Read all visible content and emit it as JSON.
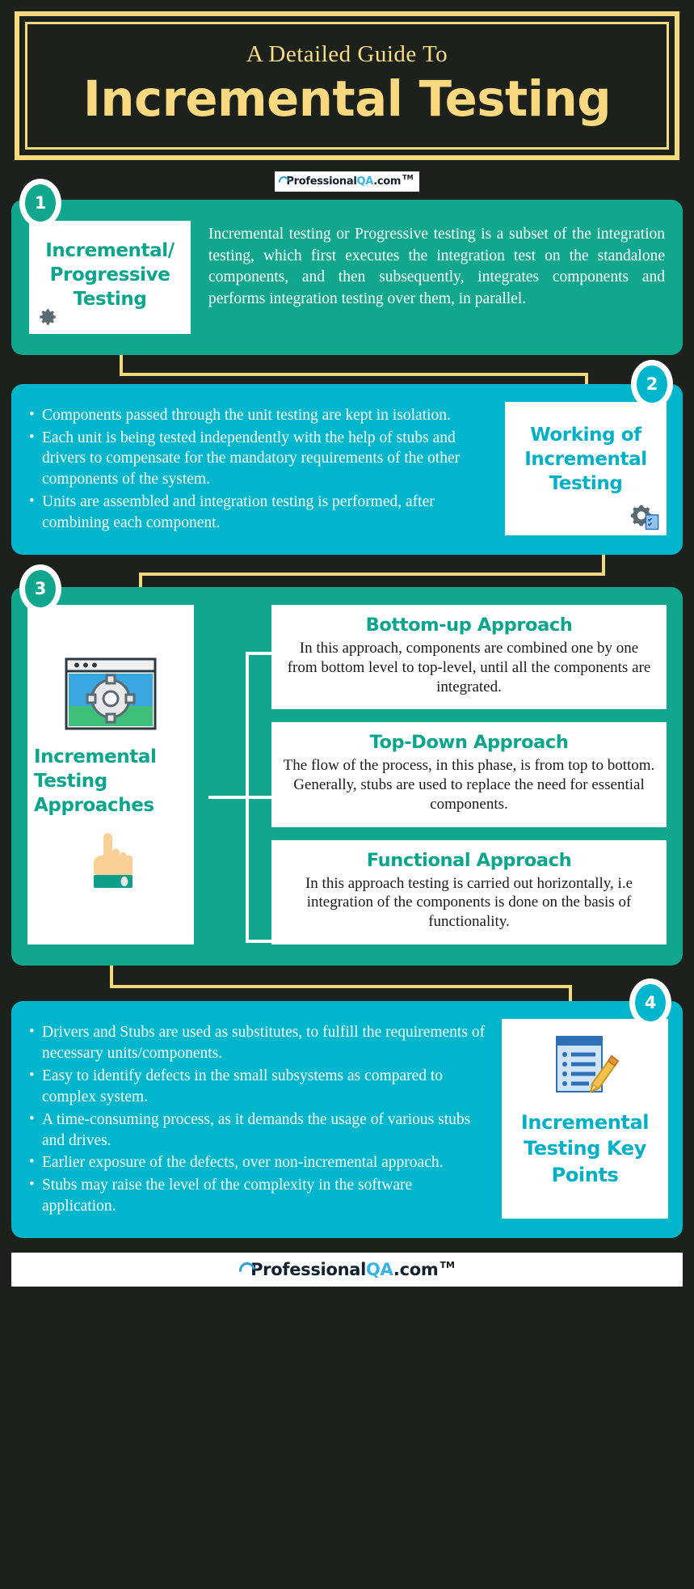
{
  "header": {
    "subtitle": "A Detailed Guide To",
    "title": "Incremental Testing",
    "frame_color": "#f7d97d",
    "background": "#1d211c"
  },
  "brand": {
    "name_part1": "Professional",
    "name_part2": "QA",
    "name_part3": ".com",
    "tm": "TM",
    "icon": "swoosh-icon"
  },
  "sections": [
    {
      "number": "1",
      "badge_color": "#11a68e",
      "panel_color": "#11a68e",
      "card_title": "Incremental/ Progressive Testing",
      "card_icon": "gear-icon",
      "paragraph": "Incremental testing or Progressive testing is a subset of the integration testing, which first executes the integration test on the standalone components, and then subsequently, integrates components and performs integration testing over them, in parallel."
    },
    {
      "number": "2",
      "badge_color": "#00b6cc",
      "panel_color": "#00b6cc",
      "card_title": "Working of Incremental Testing",
      "card_icon": "gear-checklist-icon",
      "bullets": [
        "Components passed through the unit testing are kept in isolation.",
        "Each unit is being tested independently with the help of stubs and drivers to compensate for the mandatory requirements of the other components of the system.",
        "Units are assembled and integration testing is performed, after combining each component."
      ]
    },
    {
      "number": "3",
      "badge_color": "#11a68e",
      "panel_color": "#11a68e",
      "card_title": "Incremental Testing Approaches",
      "card_icon_top": "browser-gear-icon",
      "card_icon_bottom": "pointing-hand-icon",
      "approaches": [
        {
          "heading": "Bottom-up Approach",
          "text": "In this approach, components are combined one by one from bottom level to top-level, until all the components are integrated."
        },
        {
          "heading": "Top-Down Approach",
          "text": "The flow of the process, in this phase, is from top to bottom. Generally, stubs are used to replace the need for essential components."
        },
        {
          "heading": "Functional Approach",
          "text": "In this approach testing is carried out horizontally, i.e integration of the components is done on the basis of functionality."
        }
      ]
    },
    {
      "number": "4",
      "badge_color": "#00b6cc",
      "panel_color": "#00b6cc",
      "card_title": "Incremental Testing Key Points",
      "card_icon": "notepad-pencil-icon",
      "bullets": [
        "Drivers and Stubs are used as substitutes, to fulfill the requirements of necessary units/components.",
        "Easy to identify defects in the small subsystems as compared to complex system.",
        "A time-consuming process, as it demands the usage of various stubs and drives.",
        "Earlier exposure of the defects, over non-incremental approach.",
        "Stubs may raise the level of the complexity in the software application."
      ]
    }
  ],
  "colors": {
    "teal": "#11a68e",
    "cyan": "#00b6cc",
    "gold": "#f4d87c",
    "dark": "#1d211c",
    "white": "#ffffff"
  }
}
